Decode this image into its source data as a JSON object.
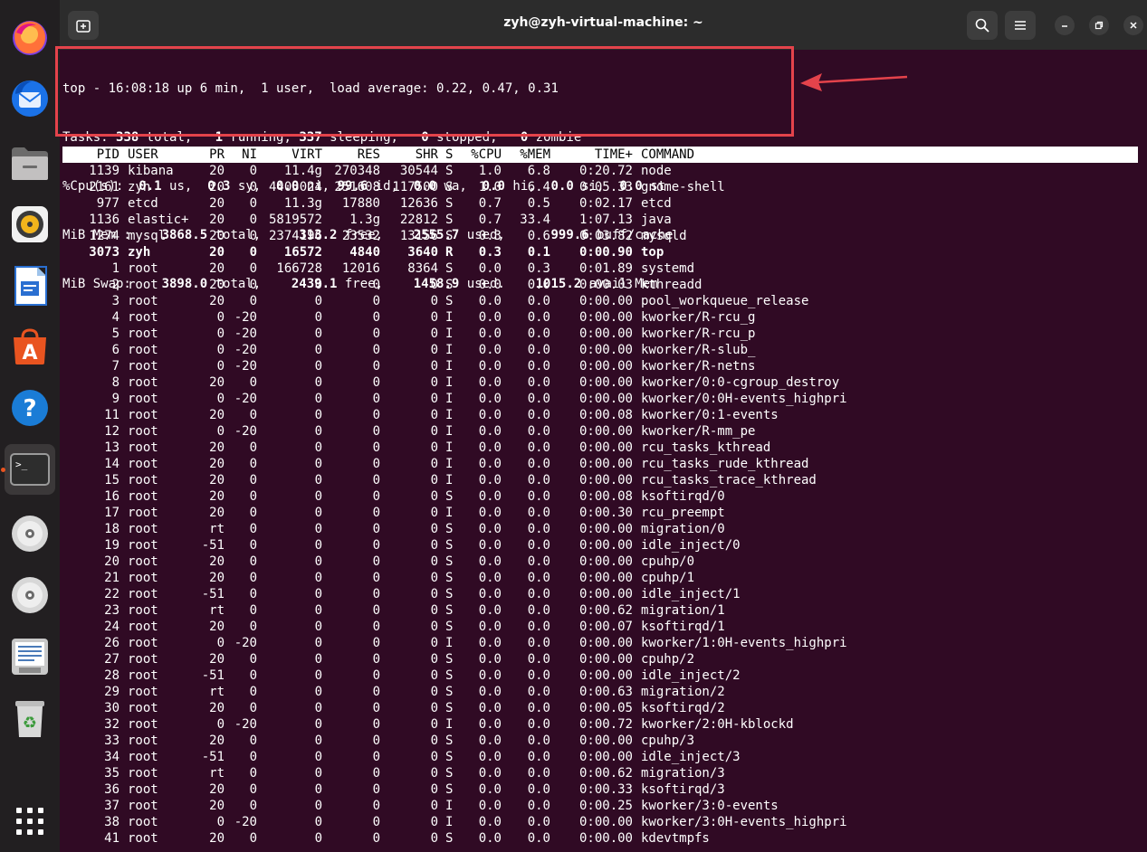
{
  "window": {
    "title": "zyh@zyh-virtual-machine: ~"
  },
  "dock": {
    "items": [
      {
        "name": "firefox-icon"
      },
      {
        "name": "thunderbird-icon"
      },
      {
        "name": "files-icon"
      },
      {
        "name": "rhythmbox-icon"
      },
      {
        "name": "libreoffice-writer-icon"
      },
      {
        "name": "app-center-icon"
      },
      {
        "name": "help-icon"
      },
      {
        "name": "terminal-icon"
      },
      {
        "name": "disc-icon"
      },
      {
        "name": "disc-icon"
      },
      {
        "name": "text-editor-icon"
      },
      {
        "name": "trash-icon"
      },
      {
        "name": "show-apps-icon"
      }
    ]
  },
  "summary": {
    "line1": "top - 16:08:18 up 6 min,  1 user,  load average: 0.22, 0.47, 0.31",
    "tasks": {
      "label": "Tasks:",
      "total": "338",
      "running": "1",
      "sleeping": "337",
      "stopped": "0",
      "zombie": "0"
    },
    "cpu": {
      "label": "%Cpu(s):",
      "us": "0.1",
      "sy": "0.3",
      "ni": "0.0",
      "id": "99.6",
      "wa": "0.0",
      "hi": "0.0",
      "si": "0.0",
      "st": "0.0"
    },
    "mem": {
      "label": "MiB Mem :",
      "total": "3868.5",
      "free": "313.2",
      "used": "2555.7",
      "buffcache": "999.6"
    },
    "swap": {
      "label": "MiB Swap:",
      "total": "3898.0",
      "free": "2439.1",
      "used": "1458.9",
      "avail": "1015.2"
    }
  },
  "columns": [
    "PID",
    "USER",
    "PR",
    "NI",
    "VIRT",
    "RES",
    "SHR",
    "S",
    "%CPU",
    "%MEM",
    "TIME+",
    "COMMAND"
  ],
  "processes": [
    [
      "1139",
      "kibana",
      "20",
      "0",
      "11.4g",
      "270348",
      "30544",
      "S",
      "1.0",
      "6.8",
      "0:20.72",
      "node"
    ],
    [
      "2161",
      "zyh",
      "20",
      "0",
      "4405024",
      "251608",
      "117500",
      "S",
      "1.0",
      "6.4",
      "0:05.33",
      "gnome-shell"
    ],
    [
      "977",
      "etcd",
      "20",
      "0",
      "11.3g",
      "17880",
      "12636",
      "S",
      "0.7",
      "0.5",
      "0:02.17",
      "etcd"
    ],
    [
      "1136",
      "elastic+",
      "20",
      "0",
      "5819572",
      "1.3g",
      "22812",
      "S",
      "0.7",
      "33.4",
      "1:07.13",
      "java"
    ],
    [
      "1274",
      "mysql",
      "20",
      "0",
      "2374196",
      "23532",
      "13156",
      "S",
      "0.3",
      "0.6",
      "0:03.82",
      "mysqld"
    ],
    [
      "3073",
      "zyh",
      "20",
      "0",
      "16572",
      "4840",
      "3640",
      "R",
      "0.3",
      "0.1",
      "0:00.90",
      "top"
    ],
    [
      "1",
      "root",
      "20",
      "0",
      "166728",
      "12016",
      "8364",
      "S",
      "0.0",
      "0.3",
      "0:01.89",
      "systemd"
    ],
    [
      "2",
      "root",
      "20",
      "0",
      "0",
      "0",
      "0",
      "S",
      "0.0",
      "0.0",
      "0:00.03",
      "kthreadd"
    ],
    [
      "3",
      "root",
      "20",
      "0",
      "0",
      "0",
      "0",
      "S",
      "0.0",
      "0.0",
      "0:00.00",
      "pool_workqueue_release"
    ],
    [
      "4",
      "root",
      "0",
      "-20",
      "0",
      "0",
      "0",
      "I",
      "0.0",
      "0.0",
      "0:00.00",
      "kworker/R-rcu_g"
    ],
    [
      "5",
      "root",
      "0",
      "-20",
      "0",
      "0",
      "0",
      "I",
      "0.0",
      "0.0",
      "0:00.00",
      "kworker/R-rcu_p"
    ],
    [
      "6",
      "root",
      "0",
      "-20",
      "0",
      "0",
      "0",
      "I",
      "0.0",
      "0.0",
      "0:00.00",
      "kworker/R-slub_"
    ],
    [
      "7",
      "root",
      "0",
      "-20",
      "0",
      "0",
      "0",
      "I",
      "0.0",
      "0.0",
      "0:00.00",
      "kworker/R-netns"
    ],
    [
      "8",
      "root",
      "20",
      "0",
      "0",
      "0",
      "0",
      "I",
      "0.0",
      "0.0",
      "0:00.00",
      "kworker/0:0-cgroup_destroy"
    ],
    [
      "9",
      "root",
      "0",
      "-20",
      "0",
      "0",
      "0",
      "I",
      "0.0",
      "0.0",
      "0:00.00",
      "kworker/0:0H-events_highpri"
    ],
    [
      "11",
      "root",
      "20",
      "0",
      "0",
      "0",
      "0",
      "I",
      "0.0",
      "0.0",
      "0:00.08",
      "kworker/0:1-events"
    ],
    [
      "12",
      "root",
      "0",
      "-20",
      "0",
      "0",
      "0",
      "I",
      "0.0",
      "0.0",
      "0:00.00",
      "kworker/R-mm_pe"
    ],
    [
      "13",
      "root",
      "20",
      "0",
      "0",
      "0",
      "0",
      "I",
      "0.0",
      "0.0",
      "0:00.00",
      "rcu_tasks_kthread"
    ],
    [
      "14",
      "root",
      "20",
      "0",
      "0",
      "0",
      "0",
      "I",
      "0.0",
      "0.0",
      "0:00.00",
      "rcu_tasks_rude_kthread"
    ],
    [
      "15",
      "root",
      "20",
      "0",
      "0",
      "0",
      "0",
      "I",
      "0.0",
      "0.0",
      "0:00.00",
      "rcu_tasks_trace_kthread"
    ],
    [
      "16",
      "root",
      "20",
      "0",
      "0",
      "0",
      "0",
      "S",
      "0.0",
      "0.0",
      "0:00.08",
      "ksoftirqd/0"
    ],
    [
      "17",
      "root",
      "20",
      "0",
      "0",
      "0",
      "0",
      "I",
      "0.0",
      "0.0",
      "0:00.30",
      "rcu_preempt"
    ],
    [
      "18",
      "root",
      "rt",
      "0",
      "0",
      "0",
      "0",
      "S",
      "0.0",
      "0.0",
      "0:00.00",
      "migration/0"
    ],
    [
      "19",
      "root",
      "-51",
      "0",
      "0",
      "0",
      "0",
      "S",
      "0.0",
      "0.0",
      "0:00.00",
      "idle_inject/0"
    ],
    [
      "20",
      "root",
      "20",
      "0",
      "0",
      "0",
      "0",
      "S",
      "0.0",
      "0.0",
      "0:00.00",
      "cpuhp/0"
    ],
    [
      "21",
      "root",
      "20",
      "0",
      "0",
      "0",
      "0",
      "S",
      "0.0",
      "0.0",
      "0:00.00",
      "cpuhp/1"
    ],
    [
      "22",
      "root",
      "-51",
      "0",
      "0",
      "0",
      "0",
      "S",
      "0.0",
      "0.0",
      "0:00.00",
      "idle_inject/1"
    ],
    [
      "23",
      "root",
      "rt",
      "0",
      "0",
      "0",
      "0",
      "S",
      "0.0",
      "0.0",
      "0:00.62",
      "migration/1"
    ],
    [
      "24",
      "root",
      "20",
      "0",
      "0",
      "0",
      "0",
      "S",
      "0.0",
      "0.0",
      "0:00.07",
      "ksoftirqd/1"
    ],
    [
      "26",
      "root",
      "0",
      "-20",
      "0",
      "0",
      "0",
      "I",
      "0.0",
      "0.0",
      "0:00.00",
      "kworker/1:0H-events_highpri"
    ],
    [
      "27",
      "root",
      "20",
      "0",
      "0",
      "0",
      "0",
      "S",
      "0.0",
      "0.0",
      "0:00.00",
      "cpuhp/2"
    ],
    [
      "28",
      "root",
      "-51",
      "0",
      "0",
      "0",
      "0",
      "S",
      "0.0",
      "0.0",
      "0:00.00",
      "idle_inject/2"
    ],
    [
      "29",
      "root",
      "rt",
      "0",
      "0",
      "0",
      "0",
      "S",
      "0.0",
      "0.0",
      "0:00.63",
      "migration/2"
    ],
    [
      "30",
      "root",
      "20",
      "0",
      "0",
      "0",
      "0",
      "S",
      "0.0",
      "0.0",
      "0:00.05",
      "ksoftirqd/2"
    ],
    [
      "32",
      "root",
      "0",
      "-20",
      "0",
      "0",
      "0",
      "I",
      "0.0",
      "0.0",
      "0:00.72",
      "kworker/2:0H-kblockd"
    ],
    [
      "33",
      "root",
      "20",
      "0",
      "0",
      "0",
      "0",
      "S",
      "0.0",
      "0.0",
      "0:00.00",
      "cpuhp/3"
    ],
    [
      "34",
      "root",
      "-51",
      "0",
      "0",
      "0",
      "0",
      "S",
      "0.0",
      "0.0",
      "0:00.00",
      "idle_inject/3"
    ],
    [
      "35",
      "root",
      "rt",
      "0",
      "0",
      "0",
      "0",
      "S",
      "0.0",
      "0.0",
      "0:00.62",
      "migration/3"
    ],
    [
      "36",
      "root",
      "20",
      "0",
      "0",
      "0",
      "0",
      "S",
      "0.0",
      "0.0",
      "0:00.33",
      "ksoftirqd/3"
    ],
    [
      "37",
      "root",
      "20",
      "0",
      "0",
      "0",
      "0",
      "I",
      "0.0",
      "0.0",
      "0:00.25",
      "kworker/3:0-events"
    ],
    [
      "38",
      "root",
      "0",
      "-20",
      "0",
      "0",
      "0",
      "I",
      "0.0",
      "0.0",
      "0:00.00",
      "kworker/3:0H-events_highpri"
    ],
    [
      "41",
      "root",
      "20",
      "0",
      "0",
      "0",
      "0",
      "S",
      "0.0",
      "0.0",
      "0:00.00",
      "kdevtmpfs"
    ]
  ],
  "highlight_row_pid": "3073",
  "colors": {
    "terminal_bg": "#300a24",
    "annotation_red": "#e4434b",
    "dock_bg": "#221f21",
    "header_bg": "#2c2c2c"
  }
}
